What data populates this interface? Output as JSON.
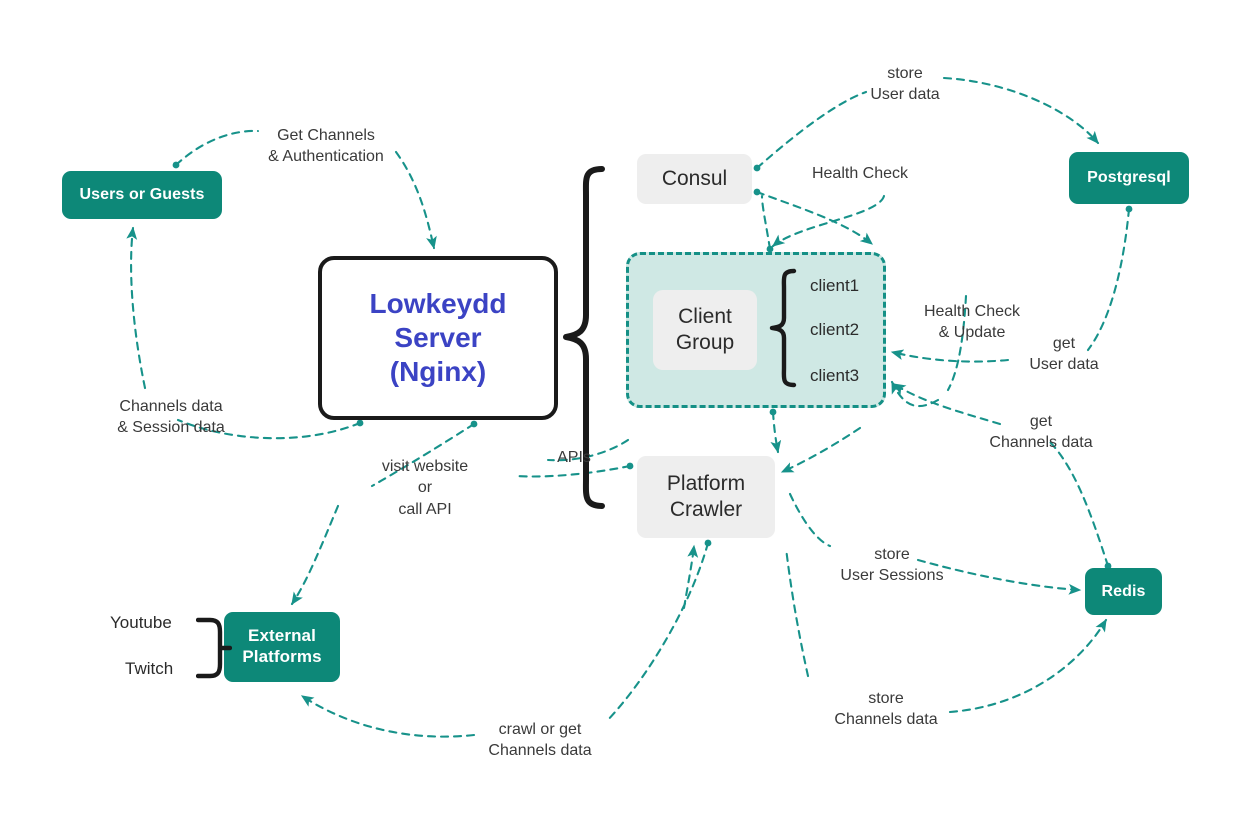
{
  "diagram": {
    "title": "Lowkeydd system architecture",
    "colors": {
      "teal": "#0d8878",
      "teal_line": "#17928a",
      "group_fill": "#cfe8e4",
      "group_border": "#159086",
      "gray_node": "#eeeeee",
      "server_text": "#3b43c4",
      "server_border": "#1a1a1a",
      "label_text": "#3a3a3a"
    }
  },
  "nodes": {
    "users_or_guests": "Users or Guests",
    "lowkeydd_server": "Lowkeydd\nServer\n(Nginx)",
    "consul": "Consul",
    "postgresql": "Postgresql",
    "client_group": "Client\nGroup",
    "platform_crawler": "Platform\nCrawler",
    "redis": "Redis",
    "external_platforms": "External\nPlatforms"
  },
  "clients": [
    {
      "label": "client1"
    },
    {
      "label": "client2"
    },
    {
      "label": "client3"
    }
  ],
  "platforms": [
    {
      "label": "Youtube"
    },
    {
      "label": "Twitch"
    }
  ],
  "edge_labels": {
    "get_channels_auth": "Get Channels\n& Authentication",
    "channels_session_data": "Channels data\n& Session data",
    "visit_or_call_api": "visit website\nor\ncall API",
    "apis": "APIs",
    "store_user_data": "store\nUser data",
    "health_check": "Health Check",
    "health_check_update": "Health Check\n& Update",
    "get_user_data": "get\nUser data",
    "get_channels_data": "get\nChannels data",
    "store_user_sessions": "store\nUser Sessions",
    "store_channels_data": "store\nChannels data",
    "crawl_or_get_channels": "crawl or get\nChannels data"
  }
}
